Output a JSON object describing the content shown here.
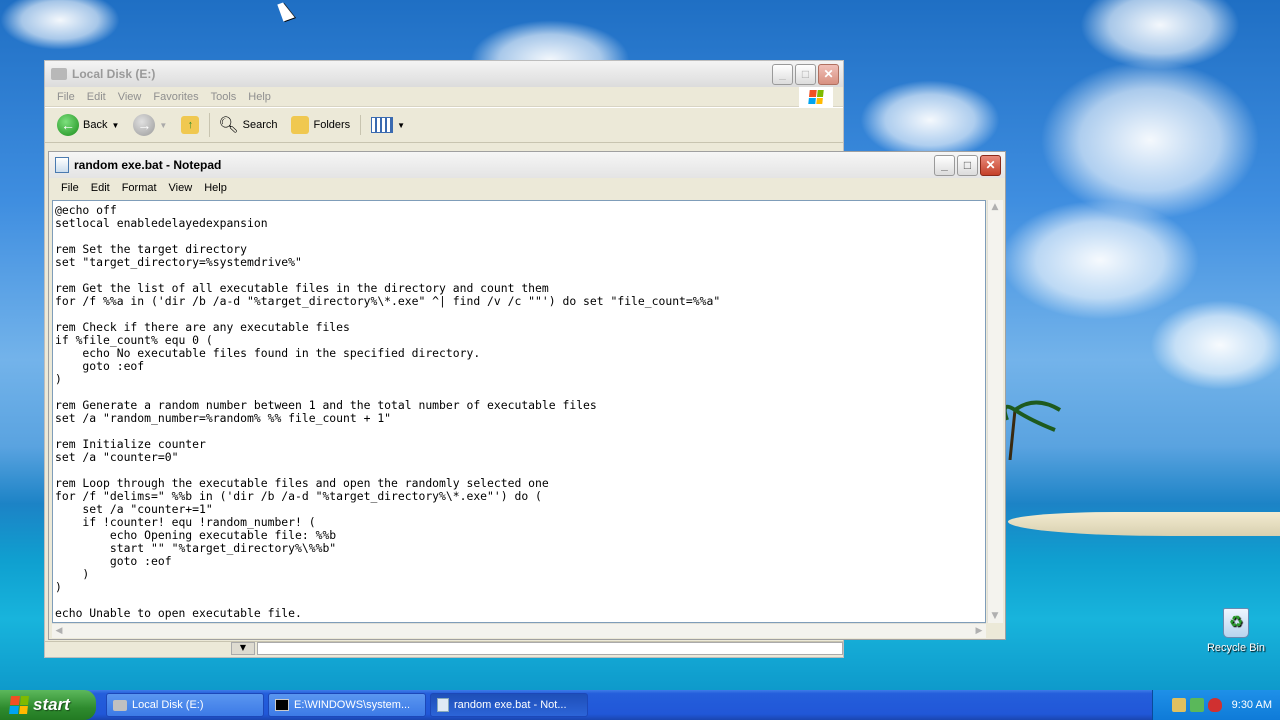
{
  "desktop": {
    "recycle_bin_label": "Recycle Bin"
  },
  "explorer": {
    "title": "Local Disk (E:)",
    "menu": [
      "File",
      "Edit",
      "View",
      "Favorites",
      "Tools",
      "Help"
    ],
    "toolbar": {
      "back_label": "Back",
      "search_label": "Search",
      "folders_label": "Folders"
    }
  },
  "notepad": {
    "title": "random exe.bat - Notepad",
    "menu": [
      "File",
      "Edit",
      "Format",
      "View",
      "Help"
    ],
    "content": "@echo off\nsetlocal enabledelayedexpansion\n\nrem Set the target directory\nset \"target_directory=%systemdrive%\"\n\nrem Get the list of all executable files in the directory and count them\nfor /f %%a in ('dir /b /a-d \"%target_directory%\\*.exe\" ^| find /v /c \"\"') do set \"file_count=%%a\"\n\nrem Check if there are any executable files\nif %file_count% equ 0 (\n    echo No executable files found in the specified directory.\n    goto :eof\n)\n\nrem Generate a random number between 1 and the total number of executable files\nset /a \"random_number=%random% %% file_count + 1\"\n\nrem Initialize counter\nset /a \"counter=0\"\n\nrem Loop through the executable files and open the randomly selected one\nfor /f \"delims=\" %%b in ('dir /b /a-d \"%target_directory%\\*.exe\"') do (\n    set /a \"counter+=1\"\n    if !counter! equ !random_number! (\n        echo Opening executable file: %%b\n        start \"\" \"%target_directory%\\%%b\"\n        goto :eof\n    )\n)\n\necho Unable to open executable file."
  },
  "taskbar": {
    "start_label": "start",
    "tasks": [
      {
        "label": "Local Disk (E:)",
        "icon": "folder-icon"
      },
      {
        "label": "E:\\WINDOWS\\system...",
        "icon": "cmd-icon"
      },
      {
        "label": "random exe.bat - Not...",
        "icon": "notepad-icon"
      }
    ],
    "clock": "9:30 AM"
  },
  "colors": {
    "taskbar_blue": "#245edb",
    "start_green": "#2e8b2e",
    "close_red": "#c4402a"
  }
}
